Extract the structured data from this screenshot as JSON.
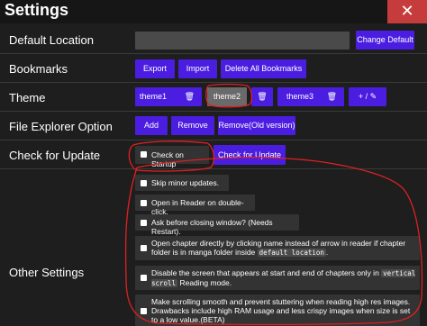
{
  "window": {
    "title": "Settings",
    "close_glyph": "✕"
  },
  "default_location": {
    "label": "Default Location",
    "value": "",
    "change_label": "Change Default"
  },
  "bookmarks": {
    "label": "Bookmarks",
    "export_label": "Export",
    "import_label": "Import",
    "delete_all_label": "Delete All Bookmarks"
  },
  "theme": {
    "label": "Theme",
    "items": [
      {
        "name": "theme1",
        "selected": false
      },
      {
        "name": "theme2",
        "selected": true
      },
      {
        "name": "theme3",
        "selected": false
      }
    ],
    "delete_icon": "🗑",
    "add_edit_label": "+ / ✎"
  },
  "file_explorer": {
    "label": "File Explorer Option",
    "add_label": "Add",
    "remove_label": "Remove",
    "remove_old_label": "Remove(Old version)"
  },
  "check_update": {
    "label": "Check for Update",
    "startup_label": "Check on Startup",
    "check_label": "Check for Update"
  },
  "other_settings": {
    "label": "Other Settings",
    "options": [
      {
        "text": "Skip minor updates.",
        "checked": false
      },
      {
        "text": "Open in Reader on double-click.",
        "checked": false
      },
      {
        "text": "Ask before closing window? (Needs Restart).",
        "checked": false
      },
      {
        "text_a": "Open chapter directly by clicking name instead of arrow in reader if chapter folder is in manga folder inside",
        "code": "default location",
        "text_b": ".",
        "checked": false
      },
      {
        "text_a": "Disable the screen that appears at start and end of chapters only in",
        "code": "vertical scroll",
        "text_b": "Reading mode.",
        "checked": false
      },
      {
        "text": "Make scrolling smooth and prevent stuttering when reading high res images. Drawbacks include high RAM usage and less crispy images when size is set to a low value.(BETA)",
        "checked": false
      }
    ]
  },
  "colors": {
    "accent": "#4a1de0",
    "background": "#1e1e1e",
    "annotation": "#e02020",
    "option_bg": "#333333"
  }
}
